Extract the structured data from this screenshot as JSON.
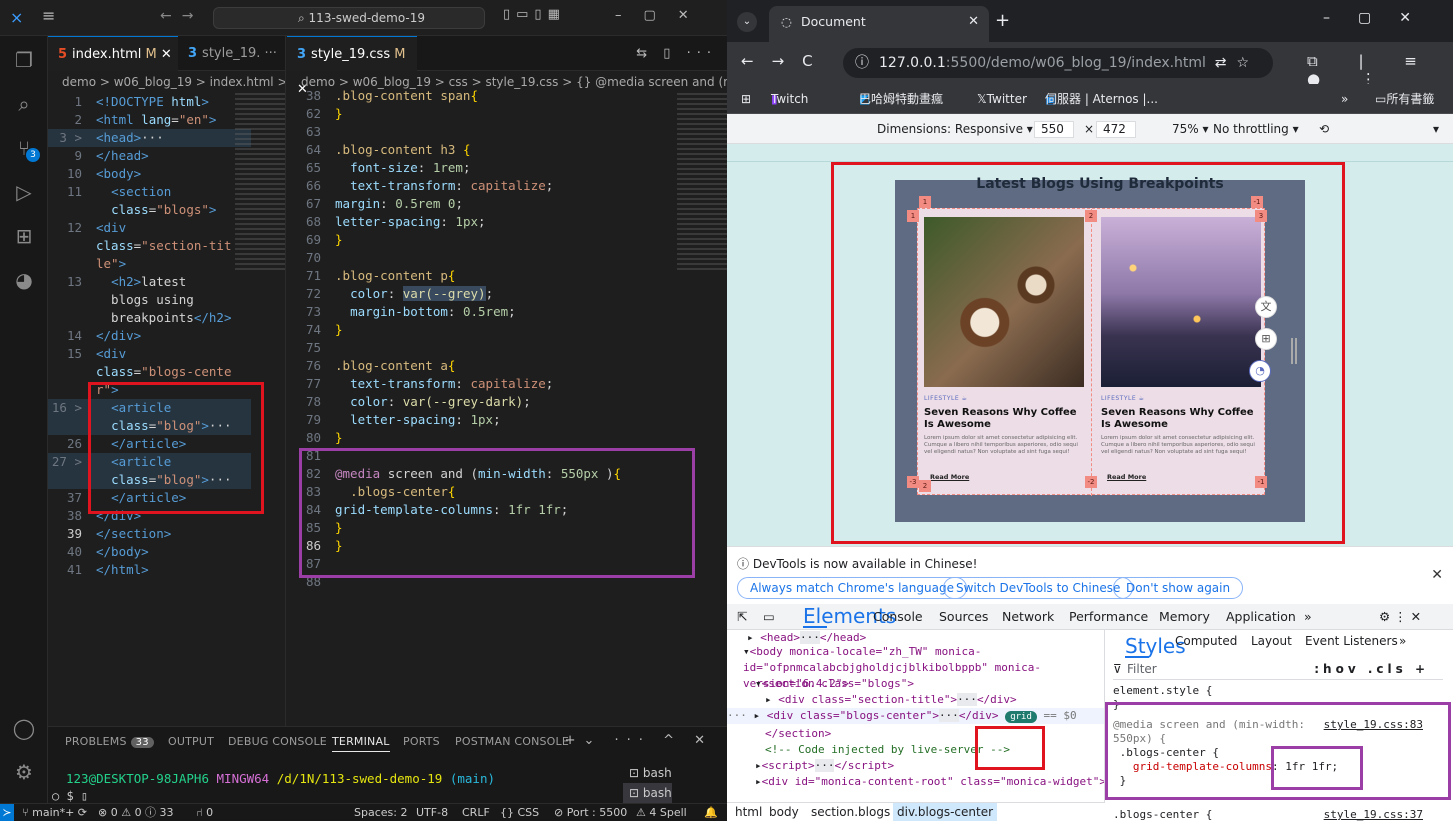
{
  "vscode": {
    "title_search": "113-swed-demo-19",
    "tabs": [
      {
        "icon": "5",
        "name": "index.html",
        "mod": "M"
      },
      {
        "icon": "3",
        "name": "style_19.",
        "mod": ""
      },
      {
        "icon": "3",
        "name": "style_19.css",
        "mod": "M"
      }
    ],
    "crumbs_left": "demo > w06_blog_19 > index.html >",
    "crumbs_right": "demo > w06_blog_19 > css > style_19.css > {} @media screen and (min-w",
    "scm_badge": "3",
    "panel": {
      "tabs": [
        "PROBLEMS",
        "OUTPUT",
        "DEBUG CONSOLE",
        "TERMINAL",
        "PORTS",
        "POSTMAN CONSOLE"
      ],
      "problems_count": "33",
      "prompt_user": "123@DESKTOP-98JAPH6",
      "prompt_host": "MINGW64",
      "prompt_path": "/d/1N/113-swed-demo-19",
      "prompt_branch": "(main)",
      "prompt_line": "$",
      "terminals": [
        "bash",
        "bash"
      ]
    },
    "status": {
      "branch": "main*+",
      "problems": "⊗ 0 ⚠ 0 ⓘ 33",
      "ports": "⑁ 0",
      "spaces": "Spaces: 2",
      "encoding": "UTF-8",
      "eol": "CRLF",
      "lang": "{} CSS",
      "port": "Port : 5500",
      "spell": "⚠ 4 Spell"
    }
  },
  "chrome": {
    "tab_title": "Document",
    "url_host": "127.0.0.1",
    "url_rest": ":5500/demo/w06_blog_19/index.html",
    "bookmarks": [
      "Twitch",
      "巴哈姆特動畫瘋",
      "Twitter",
      "伺服器 | Aternos |...",
      "»",
      "所有書籤"
    ],
    "device": {
      "dimensions": "Dimensions: Responsive ▾",
      "width": "550",
      "height": "472",
      "zoom": "75% ▾",
      "throttle": "No throttling ▾"
    },
    "page_title": "Latest Blogs Using Breakpoints",
    "cards": [
      {
        "tag": "LIFESTYLE ☕",
        "title": "Seven Reasons Why Coffee Is Awesome",
        "text": "Lorem ipsum dolor sit amet consectetur adipisicing elit. Cumque a libero nihil temporibus asperiores, odio sequi vel eligendi natus? Non voluptate ad sint fuga sequi!",
        "link": "Read More"
      },
      {
        "tag": "LIFESTYLE ☕",
        "title": "Seven Reasons Why Coffee Is Awesome",
        "text": "Lorem ipsum dolor sit amet consectetur adipisicing elit. Cumque a libero nihil temporibus asperiores, odio sequi vel eligendi natus? Non voluptate ad sint fuga sequi!",
        "link": "Read More"
      }
    ],
    "grid_labels": [
      "1",
      "1",
      "2",
      "-1",
      "3",
      "-3",
      "2",
      "-2",
      "-1"
    ],
    "notice": {
      "message": "DevTools is now available in Chinese!",
      "buttons": [
        "Always match Chrome's language",
        "Switch DevTools to Chinese",
        "Don't show again"
      ]
    },
    "devtools_tabs": [
      "Elements",
      "Console",
      "Sources",
      "Network",
      "Performance",
      "Memory",
      "Application",
      "»"
    ],
    "breadcrumbs": [
      "html",
      "body",
      "section.blogs",
      "div.blogs-center"
    ],
    "styles_tabs": [
      "Styles",
      "Computed",
      "Layout",
      "Event Listeners",
      "»"
    ],
    "filter_placeholder": "Filter",
    "filter_tools": ":hov .cls +",
    "element_style": "element.style {",
    "media_rule": "@media screen and (min-width:",
    "media_rule2": "550px) {",
    "media_link": "style_19.css:83",
    "media_selector": ".blogs-center {",
    "media_prop": "grid-template-columns",
    "media_value": "1fr 1fr;",
    "next_rule": ".blogs-center {",
    "next_link": "style_19.css:37",
    "dom": {
      "head": "<head>",
      "body_open": "<body monica-locale=\"zh_TW\" monica-id=\"ofpnmcalabcbjgholdjcjblkibolbppb\" monica-version=\"6.4.2\">",
      "section": "<section class=\"blogs\">",
      "section_title": "<div class=\"section-title\">",
      "blogs_center": "<div class=\"blogs-center\">",
      "grid_badge": "grid",
      "dollar": "== $0",
      "section_close": "</section>",
      "comment": "<!-- Code injected by live-server -->",
      "script": "<script>",
      "monica": "<div id=\"monica-content-root\" class=\"monica-widget\">"
    }
  },
  "colors": {
    "accent": "#0078d4",
    "red_annotation": "#e0141e",
    "purple_annotation": "#9b3fa6",
    "grid_overlay": "#f28b82"
  }
}
